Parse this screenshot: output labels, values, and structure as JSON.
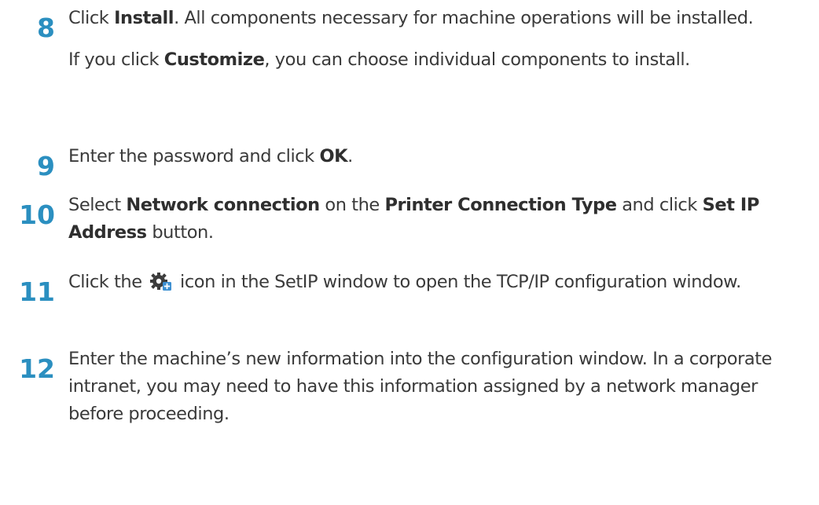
{
  "steps": [
    {
      "number": "8",
      "para1": {
        "t0": "Click ",
        "b0": "Install",
        "t1": ". All components necessary for machine operations will be installed."
      },
      "para2": {
        "t0": "If you click ",
        "b0": "Customize",
        "t1": ", you can choose individual components to install."
      }
    },
    {
      "number": "9",
      "para1": {
        "t0": "Enter the password and click ",
        "b0": "OK",
        "t1": "."
      }
    },
    {
      "number": "10",
      "para1": {
        "t0": "Select ",
        "b0": "Network connection",
        "t1": " on the ",
        "b1": "Printer Connection Type",
        "t2": " and click ",
        "b2": "Set IP Address",
        "t3": " button."
      }
    },
    {
      "number": "11",
      "para1": {
        "t0": "Click the ",
        "icon": "tcp-ip-config-icon",
        "t1": " icon in the SetIP window to open the TCP/IP configuration window."
      }
    },
    {
      "number": "12",
      "para1": {
        "t0": "Enter the machine’s new information into the configuration window. In a corporate intranet, you may need to have this information assigned by a network manager before proceeding."
      }
    }
  ],
  "colors": {
    "step_number": "#2b8fc0",
    "text": "#3a3a3a"
  }
}
